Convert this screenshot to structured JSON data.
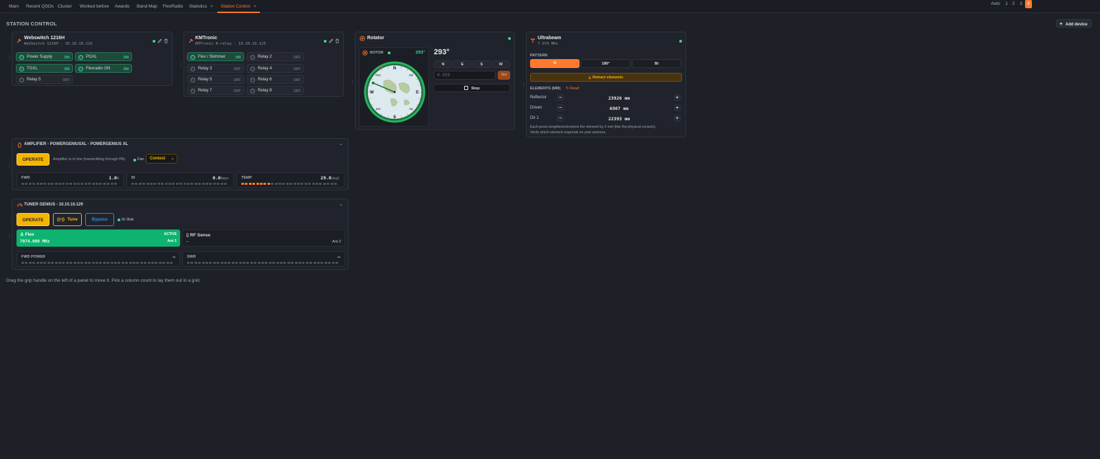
{
  "tabs": [
    {
      "label": "Main"
    },
    {
      "label": "Recent QSOs"
    },
    {
      "label": "Cluster"
    },
    {
      "label": "Worked before"
    },
    {
      "label": "Awards"
    },
    {
      "label": "Band Map"
    },
    {
      "label": "FlexRadio"
    },
    {
      "label": "Statistics",
      "close": "×"
    },
    {
      "label": "Station Control",
      "close": "×",
      "active": true
    }
  ],
  "page": {
    "title": "STATION CONTROL",
    "footer": "Drag the grip handle on the left of a panel to move it. Pick a column count to lay them out in a grid."
  },
  "columns": {
    "options": [
      "Auto",
      "1",
      "2",
      "3",
      "4"
    ],
    "selected": "4",
    "add_device": "Add device"
  },
  "webswitch": {
    "title": "Webswitch 1216H",
    "subtitle": "WebSwitch 1216H · 10.10.10.119",
    "relays": [
      {
        "label": "Power Supply",
        "state": "ON"
      },
      {
        "label": "PGXL",
        "state": "ON"
      },
      {
        "label": "TGXL",
        "state": "ON"
      },
      {
        "label": "Flexradio ON",
        "state": "ON"
      },
      {
        "label": "Relay 5",
        "state": "OFF"
      }
    ]
  },
  "kmtronic": {
    "title": "KMTronic",
    "subtitle": "KMTronic 8-relay · 10.10.10.125",
    "relays": [
      {
        "label": "Flex / Skimmer",
        "state": "ON"
      },
      {
        "label": "Relay 2",
        "state": "OFF"
      },
      {
        "label": "Relay 3",
        "state": "OFF"
      },
      {
        "label": "Relay 4",
        "state": "OFF"
      },
      {
        "label": "Relay 5",
        "state": "OFF"
      },
      {
        "label": "Relay 6",
        "state": "OFF"
      },
      {
        "label": "Relay 7",
        "state": "OFF"
      },
      {
        "label": "Relay 8",
        "state": "OFF"
      }
    ]
  },
  "rotator": {
    "title": "Rotator",
    "rotor_label": "ROTOR",
    "heading_small": "293°",
    "heading_big": "293°",
    "compass": [
      "N",
      "E",
      "S",
      "W",
      "NE",
      "SE",
      "SW",
      "NW"
    ],
    "presets": [
      "N",
      "E",
      "S",
      "W"
    ],
    "input_placeholder": "0-359",
    "go": "Go",
    "stop": "Stop",
    "heading_deg": 293
  },
  "ultrabeam": {
    "title": "Ultrabeam",
    "freq": "7.074 MHz",
    "pattern_label": "PATTERN",
    "patterns": [
      "N",
      "180°",
      "Bi"
    ],
    "retract": "Retract elements",
    "elements_label": "ELEMENTS (MM)",
    "read": "Read",
    "elements": [
      {
        "name": "Reflector",
        "value": "23926 mm"
      },
      {
        "name": "Driven",
        "value": "6987 mm"
      },
      {
        "name": "Dir 1",
        "value": "22393 mm"
      }
    ],
    "note1": "Each press lengthens/shortens the element by 2 mm (like the physical console).",
    "note2": "Verify which element responds on your antenna."
  },
  "amplifier": {
    "title": "AMPLIFIER - POWERGENIUSXL - POWERGENIUS XL",
    "operate": "OPERATE",
    "status": "Amplifier is in line (transmitting through PA)",
    "fan_label": "Fan",
    "fan_mode": "Contest",
    "meters": [
      {
        "label": "FWD",
        "value": "1.0",
        "unit": "W",
        "level": 0.0
      },
      {
        "label": "ID",
        "value": "0.0",
        "unit": "Amps",
        "level": 0.0
      },
      {
        "label": "TEMP",
        "value": "29.8",
        "unit": "degC",
        "level": 0.32
      }
    ]
  },
  "tuner": {
    "title": "TUNER GENIUS - 10.10.10.129",
    "operate": "OPERATE",
    "tune": "Tune",
    "bypass": "Bypass",
    "inline": "In line",
    "active": {
      "name": "Flex",
      "badge": "ACTIVE",
      "freq": "7074.000 MHz",
      "ant": "Ant 1"
    },
    "other": {
      "name": "RF Sense",
      "freq": "–",
      "ant": "Ant 2"
    },
    "meters": [
      {
        "label": "FWD POWER",
        "value": "–"
      },
      {
        "label": "SWR",
        "value": "–"
      }
    ]
  },
  "colors": {
    "accent": "#ff7a2f",
    "on": "#3bd39a",
    "amber": "#f5b400",
    "blue": "#2f8fd8"
  }
}
